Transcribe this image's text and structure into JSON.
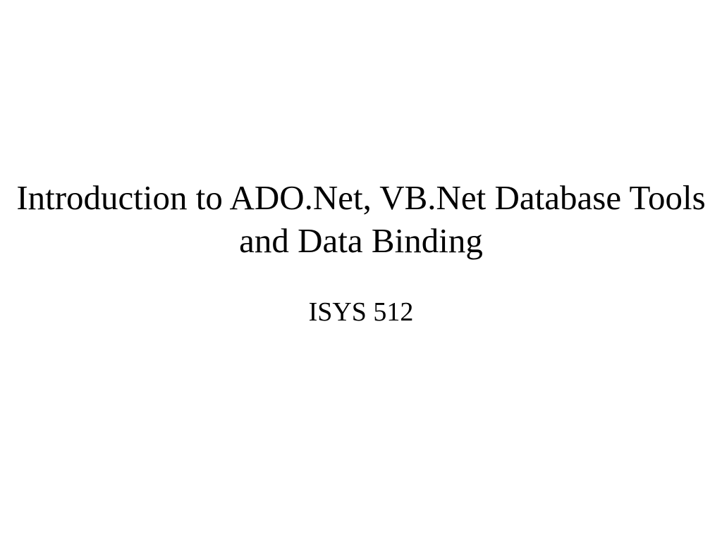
{
  "slide": {
    "title": "Introduction to ADO.Net, VB.Net Database Tools and Data Binding",
    "subtitle": "ISYS 512"
  }
}
